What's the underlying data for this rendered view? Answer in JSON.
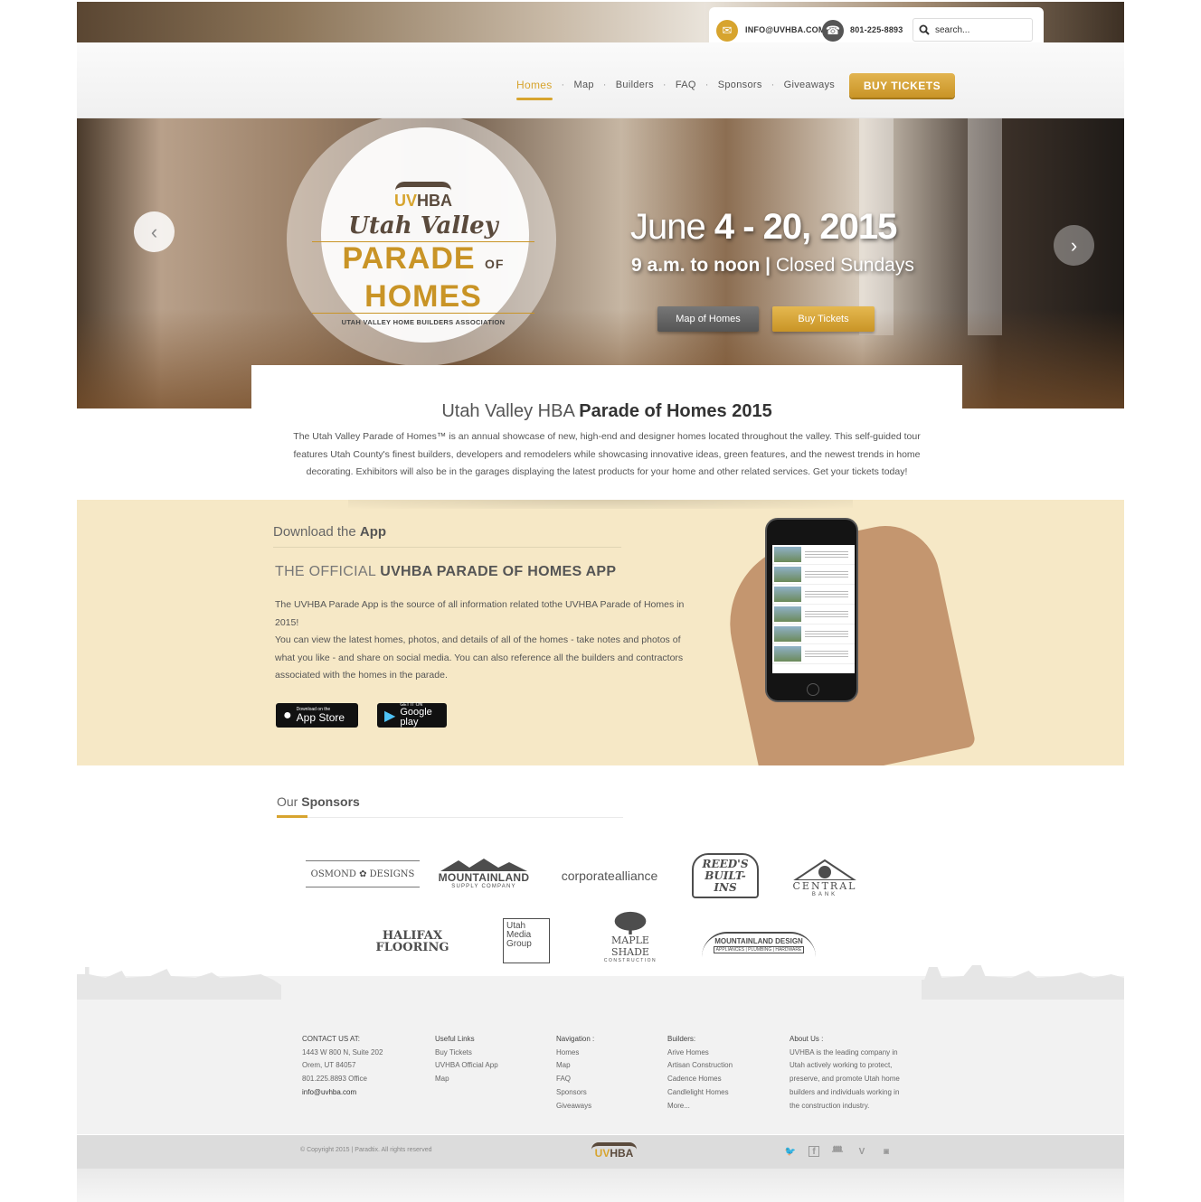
{
  "contact": {
    "email": "INFO@UVHBA.COM",
    "phone": "801-225-8893",
    "search_placeholder": "search..."
  },
  "nav": {
    "items": [
      "Homes",
      "Map",
      "Builders",
      "FAQ",
      "Sponsors",
      "Giveaways"
    ],
    "separator": "·",
    "buy_label": "BUY TICKETS"
  },
  "hero": {
    "logo": {
      "uv": "UV",
      "hba": "HBA",
      "script": "Utah Valley",
      "parade": "PARADE",
      "of": "OF",
      "homes": "HOMES",
      "association": "UTAH VALLEY HOME BUILDERS ASSOCIATION"
    },
    "date_month": "June",
    "date_range": "4 - 20, 2015",
    "hours_time": "9 a.m. to noon",
    "hours_note": "Closed Sundays",
    "btn_map": "Map of Homes",
    "btn_buy": "Buy Tickets"
  },
  "intro": {
    "title_light": "Utah Valley HBA",
    "title_bold": "Parade of Homes 2015",
    "text": "The Utah Valley Parade of Homes™ is an annual showcase of new, high-end and designer homes located throughout the valley. This self-guided tour features Utah County's finest builders, developers and remodelers while showcasing innovative ideas, green features, and the newest trends in home decorating. Exhibitors will also be in the garages displaying the latest products for your home and other related services. Get your tickets today!"
  },
  "app": {
    "title_light": "Download the",
    "title_bold": "App",
    "subtitle_light": "THE OFFICIAL",
    "subtitle_bold": "UVHBA PARADE OF HOMES APP",
    "para1": "The UVHBA Parade App is the source of all information related tothe UVHBA Parade of Homes in 2015!",
    "para2": "You can view the latest homes, photos, and details of all of the homes - take notes and photos of what you like - and share on social media. You can also reference all the builders and contractors associated with the homes in the parade.",
    "appstore_small": "Download on the",
    "appstore": "App Store",
    "google_small": "GET IT ON",
    "google": "Google play"
  },
  "sponsors": {
    "title_light": "Our",
    "title_bold": "Sponsors",
    "logos": [
      "OSMOND ✿ DESIGNS",
      "MOUNTAINLAND",
      "SUPPLY COMPANY",
      "corporatealliance",
      "REED'S BUILT-INS",
      "CENTRAL",
      "BANK",
      "HALIFAX FLOORING",
      "Utah Media Group",
      "MAPLE SHADE",
      "CONSTRUCTION",
      "MOUNTAINLAND DESIGN",
      "APPLIANCES | PLUMBING | HARDWARE"
    ]
  },
  "footer": {
    "contact": {
      "heading": "CONTACT US AT:",
      "line1": "1443 W 800 N, Suite 202",
      "line2": "Orem, UT 84057",
      "line3": "801.225.8893 Office",
      "email": "info@uvhba.com"
    },
    "useful": {
      "heading": "Useful Links",
      "links": [
        "Buy Tickets",
        "UVHBA Official App",
        "Map"
      ]
    },
    "navigation": {
      "heading": "Navigation :",
      "links": [
        "Homes",
        "Map",
        "FAQ",
        "Sponsors",
        "Giveaways"
      ]
    },
    "builders": {
      "heading": "Builders:",
      "links": [
        "Arive Homes",
        "Artisan Construction",
        "Cadence Homes",
        "Candlelight Homes",
        "More..."
      ]
    },
    "about": {
      "heading": "About Us :",
      "text": "UVHBA is the leading company in Utah actively working to protect, preserve, and promote Utah home builders and individuals working in the construction industry."
    },
    "copyright": "© Copyright 2015 | Paradtix. All rights reserved",
    "social": [
      "twitter-icon",
      "facebook-icon",
      "foursquare-icon",
      "vimeo-icon",
      "youtube-icon"
    ]
  },
  "colors": {
    "accent": "#d7a42e",
    "app_bg": "#f6e8c6",
    "footer_bg": "#f2f2f2"
  }
}
